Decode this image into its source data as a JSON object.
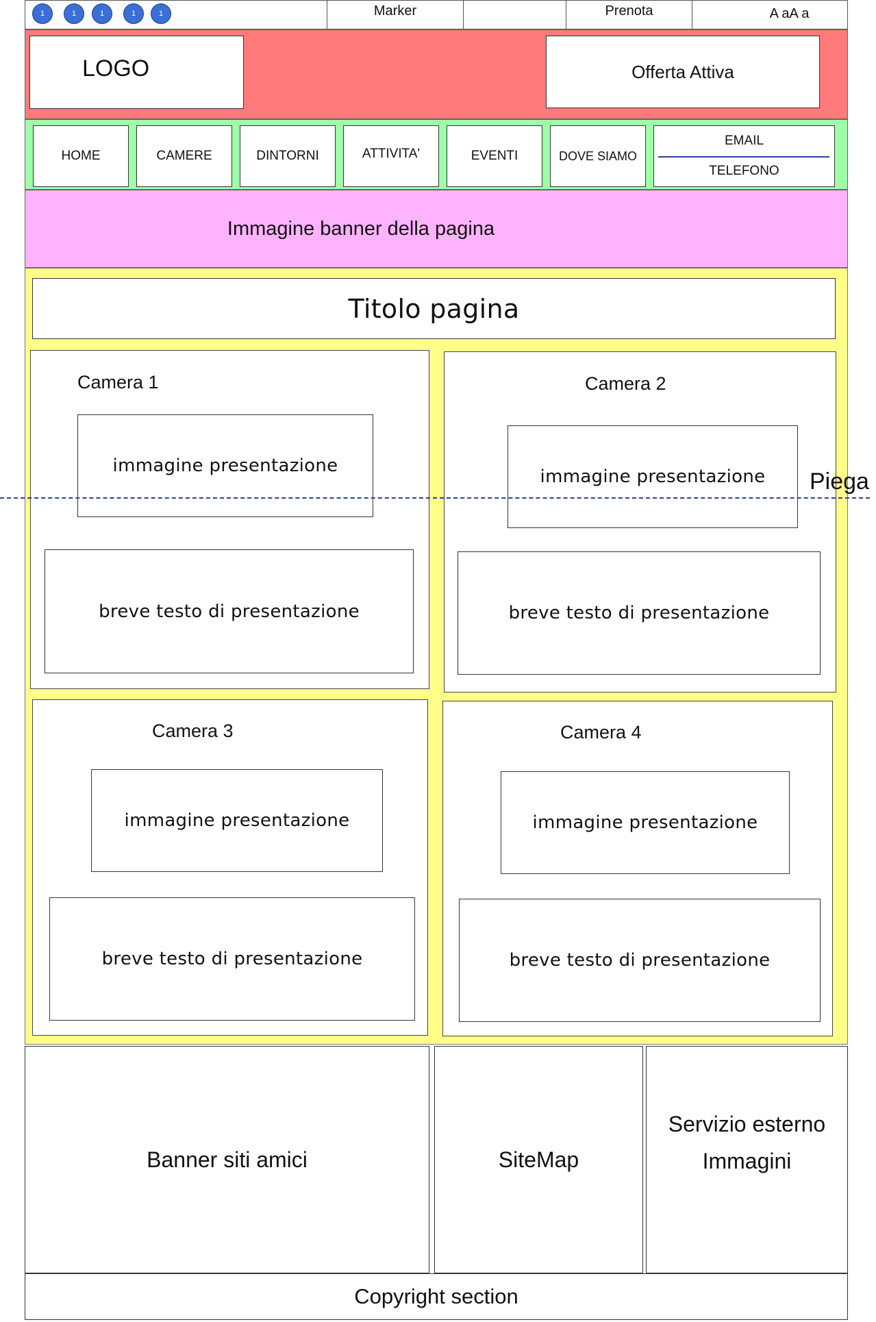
{
  "topbar": {
    "circles": [
      "1",
      "1",
      "1",
      "1",
      "1"
    ],
    "marker_label": "Marker",
    "prenota_label": "Prenota",
    "font_size_label": "A aA a"
  },
  "header": {
    "logo_label": "LOGO",
    "offer_label": "Offerta Attiva"
  },
  "nav": {
    "items": [
      "HOME",
      "CAMERE",
      "DINTORNI",
      "ATTIVITA'",
      "EVENTI",
      "DOVE SIAMO"
    ],
    "contact_email": "EMAIL",
    "contact_phone": "TELEFONO"
  },
  "banner": {
    "label": "Immagine banner della pagina"
  },
  "content": {
    "title": "Titolo pagina",
    "rooms": [
      {
        "name": "Camera 1",
        "image_label": "immagine presentazione",
        "text_label": "breve testo di presentazione"
      },
      {
        "name": "Camera 2",
        "image_label": "immagine presentazione",
        "text_label": "breve testo di presentazione"
      },
      {
        "name": "Camera 3",
        "image_label": "immagine presentazione",
        "text_label": "breve testo di presentazione"
      },
      {
        "name": "Camera 4",
        "image_label": "immagine presentazione",
        "text_label": "breve testo di presentazione"
      }
    ]
  },
  "fold": {
    "label": "Piega"
  },
  "footer": {
    "banner_label": "Banner siti amici",
    "sitemap_label": "SiteMap",
    "external_line1": "Servizio esterno",
    "external_line2": "Immagini",
    "copyright": "Copyright section"
  },
  "colors": {
    "header": "#ff7a7a",
    "nav": "#9effa9",
    "banner": "#ffb3ff",
    "content": "#ffff88",
    "circle": "#3b6fd6",
    "fold_line": "#2c3f9c"
  }
}
